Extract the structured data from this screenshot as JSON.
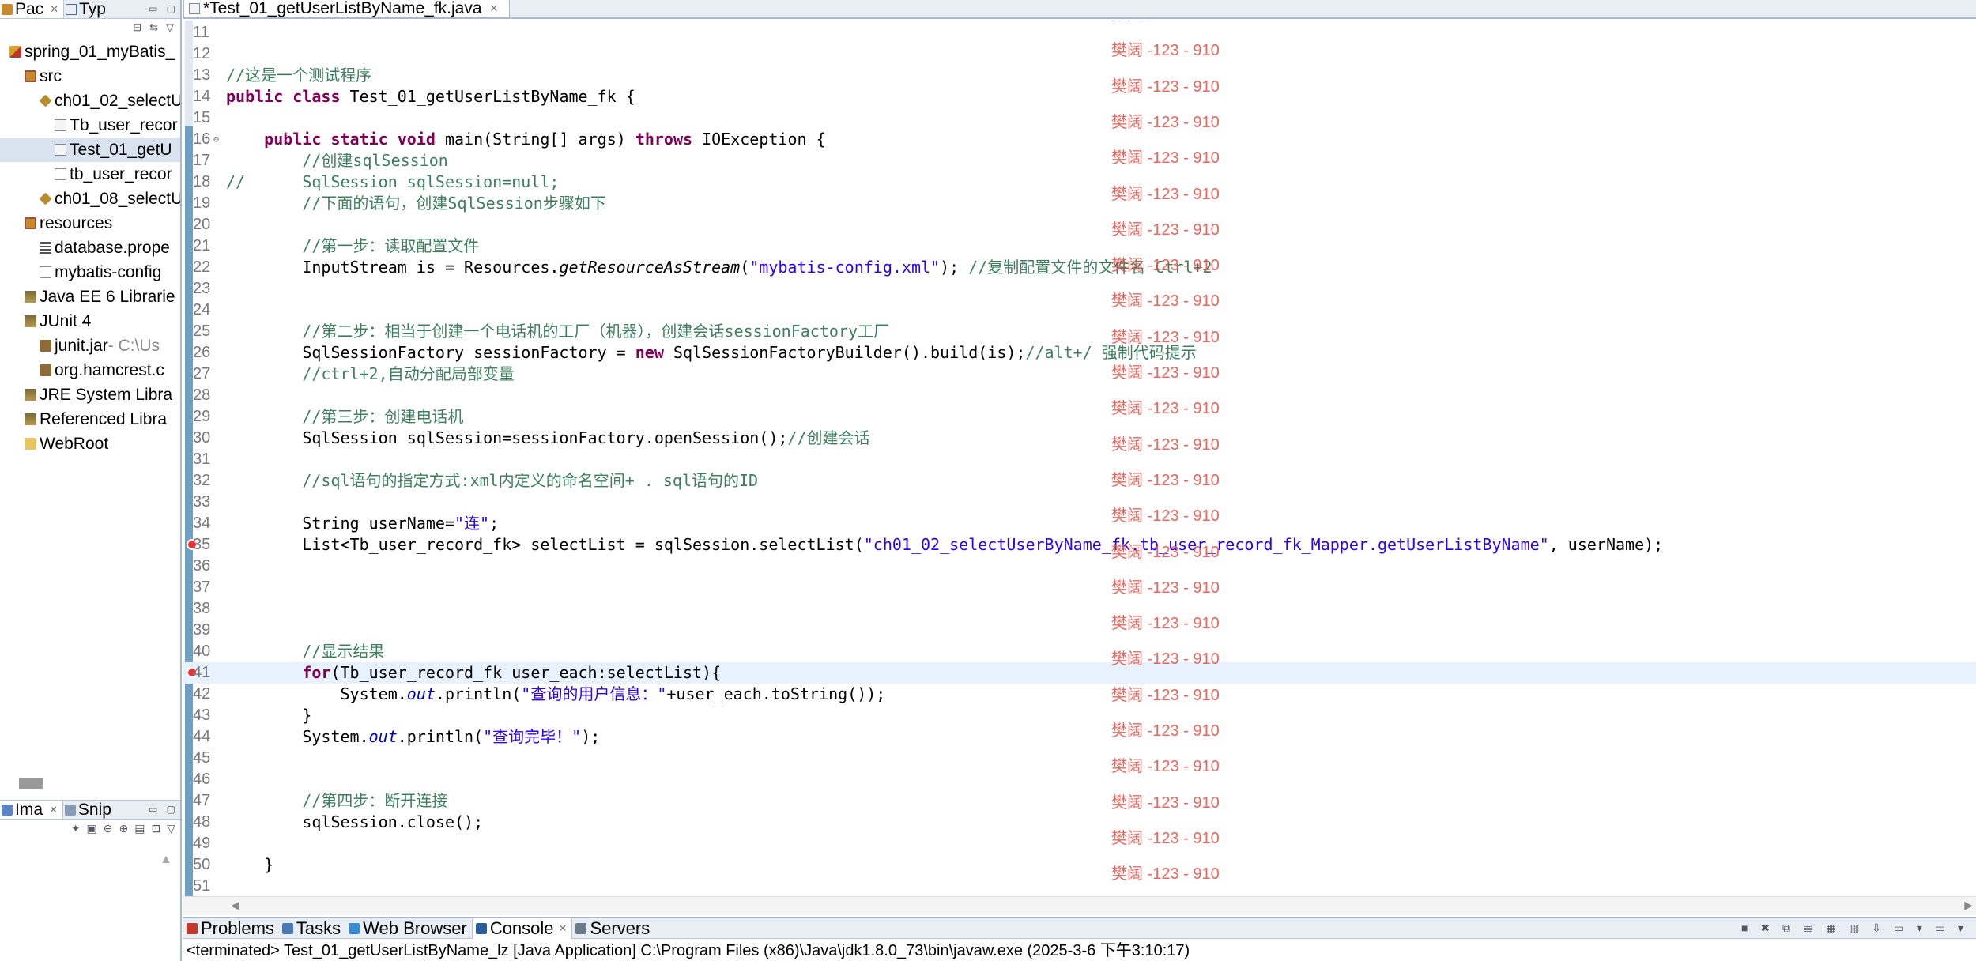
{
  "left_top": {
    "tabs": [
      {
        "label": "Pac",
        "active": true
      },
      {
        "label": "Typ",
        "active": false
      }
    ],
    "tree": [
      {
        "label": "spring_01_myBatis_",
        "icon": "project-icon",
        "indent": 0,
        "selected": false,
        "suffix": ""
      },
      {
        "label": "src",
        "icon": "source-folder-icon",
        "indent": 1,
        "selected": false,
        "suffix": ""
      },
      {
        "label": "ch01_02_selectU",
        "icon": "package-icon",
        "indent": 2,
        "selected": false,
        "suffix": ""
      },
      {
        "label": "Tb_user_recor",
        "icon": "java-file-icon",
        "indent": 3,
        "selected": false,
        "suffix": ""
      },
      {
        "label": "Test_01_getU",
        "icon": "java-file-icon",
        "indent": 3,
        "selected": true,
        "suffix": ""
      },
      {
        "label": "tb_user_recor",
        "icon": "xml-file-icon",
        "indent": 3,
        "selected": false,
        "suffix": ""
      },
      {
        "label": "ch01_08_selectU",
        "icon": "package-icon",
        "indent": 2,
        "selected": false,
        "suffix": ""
      },
      {
        "label": "resources",
        "icon": "source-folder-icon",
        "indent": 1,
        "selected": false,
        "suffix": ""
      },
      {
        "label": "database.prope",
        "icon": "properties-file-icon",
        "indent": 2,
        "selected": false,
        "suffix": ""
      },
      {
        "label": "mybatis-config",
        "icon": "xml-file-icon",
        "indent": 2,
        "selected": false,
        "suffix": ""
      },
      {
        "label": "Java EE 6 Librarie",
        "icon": "library-icon",
        "indent": 1,
        "selected": false,
        "suffix": ""
      },
      {
        "label": "JUnit 4",
        "icon": "library-icon",
        "indent": 1,
        "selected": false,
        "suffix": ""
      },
      {
        "label": "junit.jar",
        "icon": "jar-icon",
        "indent": 2,
        "selected": false,
        "suffix": " - C:\\Us"
      },
      {
        "label": "org.hamcrest.c",
        "icon": "jar-icon",
        "indent": 2,
        "selected": false,
        "suffix": ""
      },
      {
        "label": "JRE System Libra",
        "icon": "library-icon",
        "indent": 1,
        "selected": false,
        "suffix": ""
      },
      {
        "label": "Referenced Libra",
        "icon": "library-icon",
        "indent": 1,
        "selected": false,
        "suffix": ""
      },
      {
        "label": "WebRoot",
        "icon": "folder-icon",
        "indent": 1,
        "selected": false,
        "suffix": ""
      }
    ]
  },
  "left_bottom": {
    "tabs": [
      {
        "label": "Ima",
        "active": true
      },
      {
        "label": "Snip",
        "active": false
      }
    ]
  },
  "editor": {
    "tab_label": "*Test_01_getUserListByName_fk.java",
    "watermark_text": "樊阔 -123 - 910",
    "lines": [
      {
        "n": "11",
        "segs": []
      },
      {
        "n": "12",
        "segs": []
      },
      {
        "n": "13",
        "segs": [
          [
            "cm",
            "//这是一个测试程序"
          ]
        ]
      },
      {
        "n": "14",
        "segs": [
          [
            "kw",
            "public"
          ],
          [
            "",
            " "
          ],
          [
            "kw",
            "class"
          ],
          [
            "",
            " Test_01_getUserListByName_fk {"
          ]
        ]
      },
      {
        "n": "15",
        "segs": []
      },
      {
        "n": "16",
        "fold": true,
        "segs": [
          [
            "",
            "    "
          ],
          [
            "kw",
            "public"
          ],
          [
            "",
            " "
          ],
          [
            "kw",
            "static"
          ],
          [
            "",
            " "
          ],
          [
            "kw",
            "void"
          ],
          [
            "",
            " main(String[] args) "
          ],
          [
            "kw",
            "throws"
          ],
          [
            "",
            " IOException {"
          ]
        ]
      },
      {
        "n": "17",
        "segs": [
          [
            "",
            "        "
          ],
          [
            "cm",
            "//创建sqlSession"
          ]
        ]
      },
      {
        "n": "18",
        "segs": [
          [
            "cm",
            "//      SqlSession sqlSession=null;"
          ]
        ]
      },
      {
        "n": "19",
        "segs": [
          [
            "",
            "        "
          ],
          [
            "cm",
            "//下面的语句，创建SqlSession步骤如下"
          ]
        ]
      },
      {
        "n": "20",
        "segs": []
      },
      {
        "n": "21",
        "segs": [
          [
            "",
            "        "
          ],
          [
            "cm",
            "//第一步：读取配置文件"
          ]
        ]
      },
      {
        "n": "22",
        "segs": [
          [
            "",
            "        InputStream is = Resources."
          ],
          [
            "it",
            "getResourceAsStream"
          ],
          [
            "",
            "("
          ],
          [
            "st",
            "\"mybatis-config.xml\""
          ],
          [
            "",
            "); "
          ],
          [
            "cm",
            "//复制配置文件的文件名 Ctrl+2"
          ]
        ]
      },
      {
        "n": "23",
        "segs": []
      },
      {
        "n": "24",
        "segs": []
      },
      {
        "n": "25",
        "segs": [
          [
            "",
            "        "
          ],
          [
            "cm",
            "//第二步：相当于创建一个电话机的工厂（机器），创建会话sessionFactory工厂"
          ]
        ]
      },
      {
        "n": "26",
        "segs": [
          [
            "",
            "        SqlSessionFactory sessionFactory = "
          ],
          [
            "kw",
            "new"
          ],
          [
            "",
            " SqlSessionFactoryBuilder().build(is);"
          ],
          [
            "cm",
            "//alt+/ 强制代码提示"
          ]
        ]
      },
      {
        "n": "27",
        "segs": [
          [
            "",
            "        "
          ],
          [
            "cm",
            "//ctrl+2,自动分配局部变量"
          ]
        ]
      },
      {
        "n": "28",
        "segs": []
      },
      {
        "n": "29",
        "segs": [
          [
            "",
            "        "
          ],
          [
            "cm",
            "//第三步：创建电话机"
          ]
        ]
      },
      {
        "n": "30",
        "segs": [
          [
            "",
            "        SqlSession sqlSession=sessionFactory.openSession();"
          ],
          [
            "cm",
            "//创建会话"
          ]
        ]
      },
      {
        "n": "31",
        "segs": []
      },
      {
        "n": "32",
        "segs": [
          [
            "",
            "        "
          ],
          [
            "cm",
            "//sql语句的指定方式:xml内定义的命名空间+ . sql语句的ID"
          ]
        ]
      },
      {
        "n": "33",
        "segs": []
      },
      {
        "n": "34",
        "segs": [
          [
            "",
            "        String userName="
          ],
          [
            "st",
            "\"连\""
          ],
          [
            "",
            ";"
          ]
        ]
      },
      {
        "n": "35",
        "error": true,
        "segs": [
          [
            "",
            "        List<Tb_user_record_fk> selectList = sqlSession.selectList("
          ],
          [
            "st",
            "\"ch01_02_selectUserByName_fk.tb_user_record_fk_Mapper.getUserListByName\""
          ],
          [
            "",
            ", userName);"
          ]
        ]
      },
      {
        "n": "36",
        "segs": []
      },
      {
        "n": "37",
        "segs": []
      },
      {
        "n": "38",
        "segs": []
      },
      {
        "n": "39",
        "segs": []
      },
      {
        "n": "40",
        "segs": [
          [
            "",
            "        "
          ],
          [
            "cm",
            "//显示结果"
          ]
        ]
      },
      {
        "n": "41",
        "error": true,
        "current": true,
        "segs": [
          [
            "",
            "        "
          ],
          [
            "kw",
            "for"
          ],
          [
            "",
            "(Tb_user_record_fk user_each:selectList){"
          ]
        ]
      },
      {
        "n": "42",
        "segs": [
          [
            "",
            "            System."
          ],
          [
            "fld",
            "out"
          ],
          [
            "",
            ".println("
          ],
          [
            "st",
            "\"查询的用户信息：\""
          ],
          [
            "",
            "+user_each.toString());"
          ]
        ]
      },
      {
        "n": "43",
        "segs": [
          [
            "",
            "        }"
          ]
        ]
      },
      {
        "n": "44",
        "segs": [
          [
            "",
            "        System."
          ],
          [
            "fld",
            "out"
          ],
          [
            "",
            ".println("
          ],
          [
            "st",
            "\"查询完毕！\""
          ],
          [
            "",
            ");"
          ]
        ]
      },
      {
        "n": "45",
        "segs": []
      },
      {
        "n": "46",
        "segs": []
      },
      {
        "n": "47",
        "segs": [
          [
            "",
            "        "
          ],
          [
            "cm",
            "//第四步：断开连接"
          ]
        ]
      },
      {
        "n": "48",
        "segs": [
          [
            "",
            "        sqlSession.close();"
          ]
        ]
      },
      {
        "n": "49",
        "segs": []
      },
      {
        "n": "50",
        "segs": [
          [
            "",
            "    }"
          ]
        ]
      },
      {
        "n": "51",
        "segs": []
      }
    ]
  },
  "console": {
    "tabs": [
      {
        "label": "Problems",
        "active": false,
        "icon": "problems-icon"
      },
      {
        "label": "Tasks",
        "active": false,
        "icon": "tasks-icon"
      },
      {
        "label": "Web Browser",
        "active": false,
        "icon": "globe-icon"
      },
      {
        "label": "Console",
        "active": true,
        "icon": "console-icon"
      },
      {
        "label": "Servers",
        "active": false,
        "icon": "servers-icon"
      }
    ],
    "status": "<terminated> Test_01_getUserListByName_lz [Java Application] C:\\Program Files (x86)\\Java\\jdk1.8.0_73\\bin\\javaw.exe (2025-3-6 下午3:10:17)"
  }
}
